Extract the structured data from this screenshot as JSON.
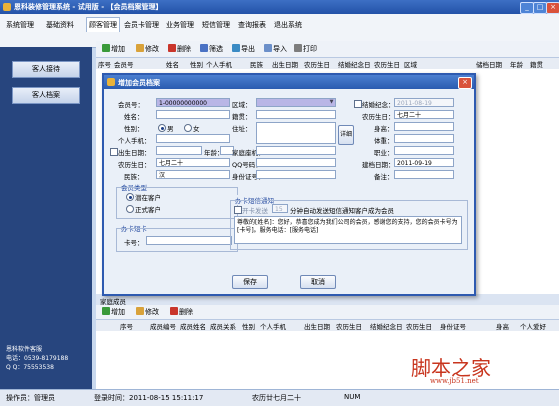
{
  "window": {
    "title": "恩科装修管理系统 - 试用版 - 【会员档案管理】",
    "min": "_",
    "max": "□",
    "close": "×"
  },
  "menu": [
    "系统管理",
    "基础资料",
    "顾客管理",
    "会员卡管理",
    "业务管理",
    "短信管理",
    "查询报表",
    "退出系统"
  ],
  "sidebar": {
    "buttons": [
      "客人接待",
      "客人档案"
    ],
    "company": "恩科软件客服",
    "phone": "电话：0539-8179188",
    "qq": "Q Q：75553538"
  },
  "toolbar": [
    "增加",
    "修改",
    "删除",
    "筛选",
    "导出",
    "导入",
    "打印"
  ],
  "grid_columns": [
    "序号",
    "会员号",
    "姓名",
    "性别",
    "个人手机",
    "民族",
    "出生日期",
    "农历生日",
    "结婚纪念日",
    "农历生日",
    "区域",
    "",
    "",
    "储档日期",
    "年龄",
    "籍贯"
  ],
  "dialog": {
    "title": "增加会员档案",
    "close": "×",
    "labels": {
      "member_no": "会员号：",
      "name": "姓名：",
      "gender": "性别：",
      "mobile": "个人手机：",
      "birth": "出生日期：",
      "age": "年龄：",
      "lunar": "农历生日：",
      "ethnic": "民族：",
      "region": "区域：",
      "native": "籍贯：",
      "address": "住址：",
      "home_phone": "家庭座机：",
      "qq": "QQ号码：",
      "id_card": "身份证号：",
      "anniv": "结婚纪念：",
      "anniv_lunar": "农历生日：",
      "height": "身高：",
      "weight": "体重：",
      "job": "职业：",
      "file_date": "建档日期：",
      "remark": "备注：",
      "male": "男",
      "female": "女",
      "addr_btn": "详细",
      "member_type": "会员类型",
      "potential": "潜在客户",
      "formal": "正式客户",
      "card_group": "办卡短卡",
      "card_no": "卡号：",
      "sms_group": "办卡短信通知",
      "auto_send": "开卡发送 ",
      "auto_text": "分钟自动发送短信通知客户成为会员",
      "save": "保存",
      "cancel": "取消"
    },
    "values": {
      "member_no": "1-00000000000",
      "name_lunar": "七月二十",
      "anniv_date": "2011-08-19",
      "lunar_birth": "七月二十",
      "ethnic": "汉",
      "file_date": "2011-09-19",
      "minutes": "15",
      "sms_text": "尊敬的[姓名]：您好，恭喜您成为我们公司的会员，感谢您的支持，您的会员卡号为[卡号]。服务电话：[服务电话]"
    }
  },
  "members_section": {
    "title": "家庭成员",
    "toolbar": [
      "增加",
      "修改",
      "删除"
    ],
    "columns": [
      "序号",
      "成员编号",
      "成员姓名",
      "成员关系",
      "性别",
      "个人手机",
      "出生日期",
      "农历生日",
      "结婚纪念日",
      "农历生日",
      "身份证号",
      "身高",
      "个人爱好"
    ]
  },
  "status": [
    "操作员：管理员",
    "登录时间：2011-08-15 15:11:17",
    "农历廿七月二十",
    "NUM"
  ],
  "watermark": {
    "brand": "脚本之家",
    "url": "www.jb51.net"
  }
}
